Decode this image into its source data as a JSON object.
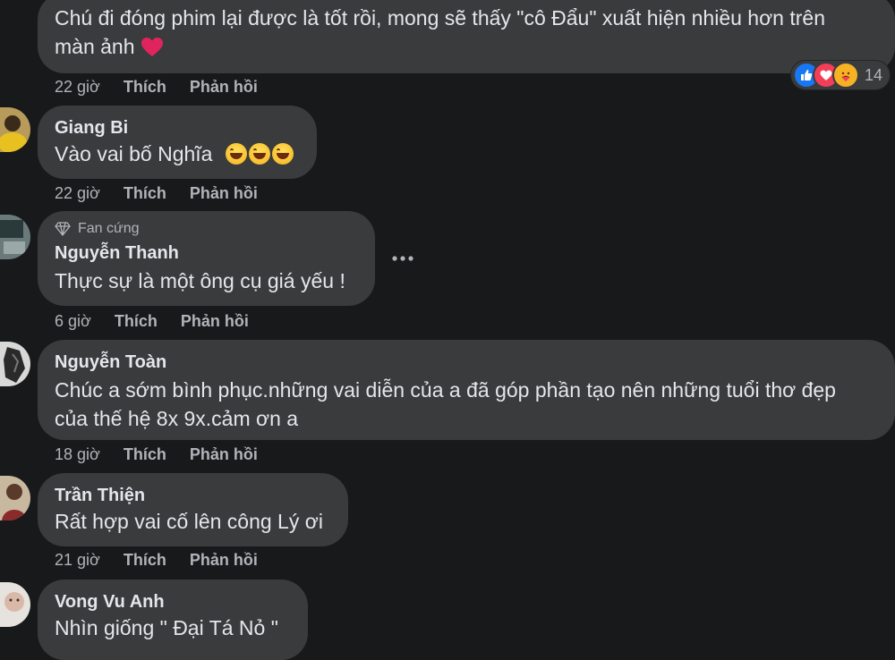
{
  "comments": [
    {
      "author": "",
      "text": "Chú đi đóng phim lại được là tốt rồi, mong sẽ thấy \"cô Đẩu\" xuất hiện nhiều hơn trên màn ảnh",
      "text_line1": "Chú đi đóng phim lại được là tốt rồi, mong sẽ thấy \"cô Đẩu\" xuất hiện nhiều hơn trên",
      "text_line2": "màn ảnh",
      "emoji": "heart-icon",
      "time": "22 giờ",
      "like": "Thích",
      "reply": "Phản hồi",
      "reaction_count": "14"
    },
    {
      "author": "Giang Bi",
      "text": "Vào vai bố Nghĩa",
      "emoji": "laughing-emoji",
      "time": "22 giờ",
      "like": "Thích",
      "reply": "Phản hồi"
    },
    {
      "badge": "Fan cứng",
      "author": "Nguyễn Thanh",
      "text": "Thực sự là một ông cụ giá yếu !",
      "time": "6 giờ",
      "like": "Thích",
      "reply": "Phản hồi"
    },
    {
      "author": "Nguyễn Toàn",
      "text_line1": "Chúc a sớm bình phục.những vai diễn của a đã góp phần tạo nên những tuổi thơ đẹp",
      "text_line2": "của thế hệ 8x 9x.cảm ơn a",
      "time": "18 giờ",
      "like": "Thích",
      "reply": "Phản hồi"
    },
    {
      "author": "Trần Thiện",
      "text": "Rất hợp vai cố lên công Lý ơi",
      "time": "21 giờ",
      "like": "Thích",
      "reply": "Phản hồi"
    },
    {
      "author": "Vong Vu Anh",
      "text": "Nhìn giống \" Đại Tá Nỏ \""
    }
  ],
  "colors": {
    "background": "#18191a",
    "bubble": "#3a3b3c",
    "text": "#e4e6eb",
    "secondary_text": "#b0b3b8",
    "like_blue": "#1877f2",
    "love_red": "#f33e58",
    "care_yellow": "#f7b125"
  },
  "icons": [
    "like-reaction-icon",
    "love-reaction-icon",
    "care-reaction-icon",
    "diamond-icon",
    "more-options-icon",
    "heart-icon",
    "laughing-emoji"
  ]
}
